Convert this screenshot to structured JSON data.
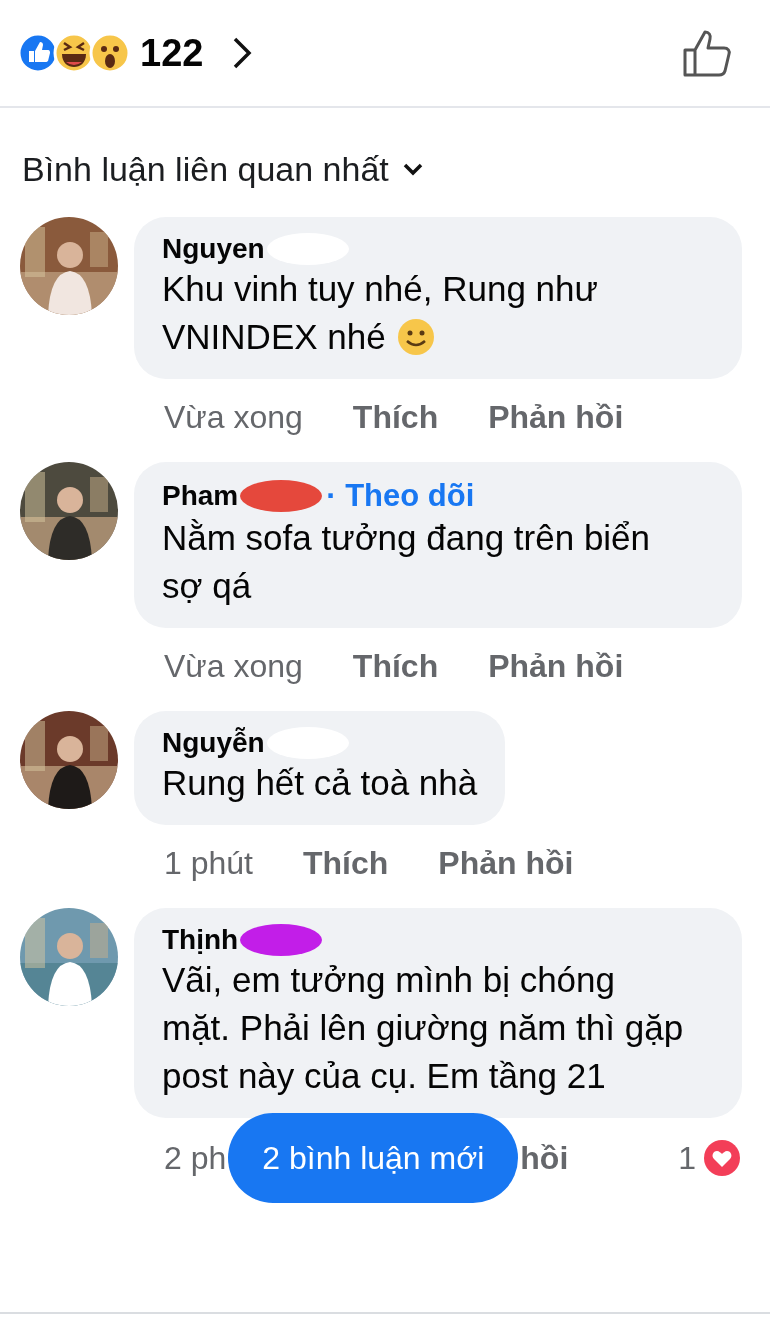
{
  "reactions": {
    "count": "122"
  },
  "sort": {
    "label": "Bình luận liên quan nhất"
  },
  "comments": [
    {
      "name": "Nguyen",
      "redaction": {
        "color": "#ffffff"
      },
      "text": "Khu vinh tuy nhé, Rung như VNINDEX nhé",
      "emoji": true,
      "actions": [
        {
          "kind": "time",
          "text": "Vừa xong"
        },
        {
          "kind": "like",
          "text": "Thích"
        },
        {
          "kind": "reply",
          "text": "Phản hồi"
        }
      ]
    },
    {
      "name": "Pham",
      "redaction": {
        "color": "#e5483c"
      },
      "follow": "· Theo dõi",
      "text": "Nằm sofa tưởng đang trên biển sợ qá",
      "actions": [
        {
          "kind": "time",
          "text": "Vừa xong"
        },
        {
          "kind": "like",
          "text": "Thích"
        },
        {
          "kind": "reply",
          "text": "Phản hồi"
        }
      ]
    },
    {
      "name": "Nguyễn",
      "redaction": {
        "color": "#ffffff"
      },
      "text": "Rung hết cả toà nhà",
      "actions": [
        {
          "kind": "time",
          "text": "1 phút"
        },
        {
          "kind": "like",
          "text": "Thích"
        },
        {
          "kind": "reply",
          "text": "Phản hồi"
        }
      ]
    },
    {
      "name": "Thịnh",
      "redaction": {
        "color": "#c21ee8"
      },
      "text": "Vãi, em tưởng mình bị chóng mặt. Phải lên giường năm thì gặp post này của cụ. Em tầng 21",
      "actions": [
        {
          "kind": "time",
          "text": "2 ph"
        },
        {
          "kind": "reply",
          "text": "hồi"
        }
      ],
      "love_count": "1"
    }
  ],
  "new_comments": "2 bình luận mới"
}
